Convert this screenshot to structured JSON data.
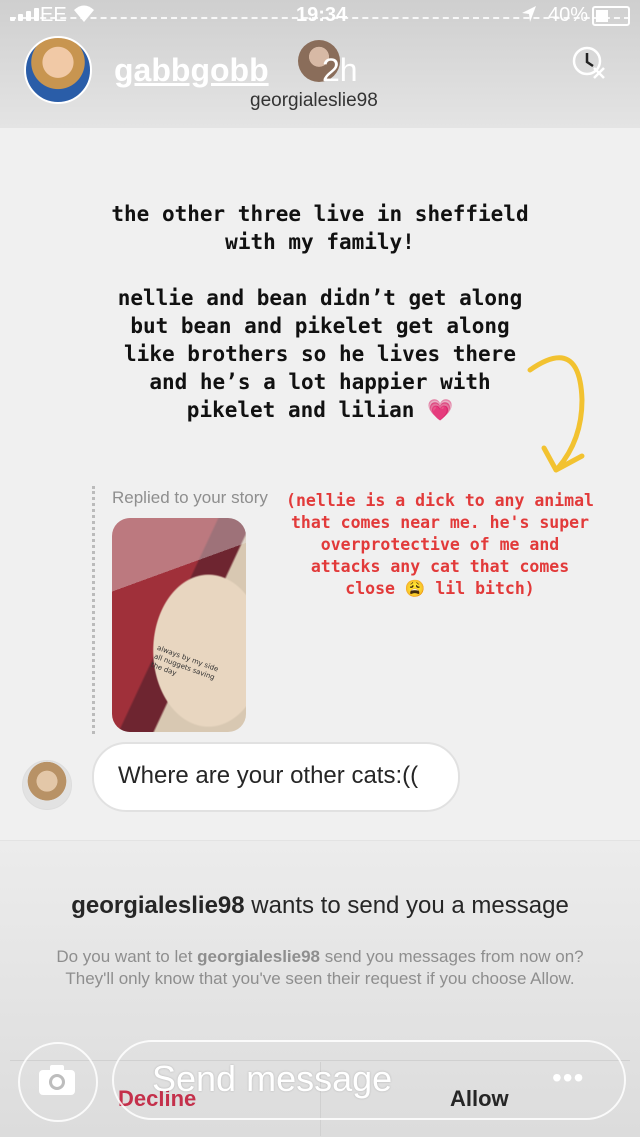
{
  "status_bar": {
    "carrier": "EE",
    "time": "19:34",
    "battery": "40%"
  },
  "story_header": {
    "username": "gabbgobb",
    "time_ago": "2h",
    "sender": "georgialeslie98"
  },
  "story": {
    "paragraph1": "the other three live in sheffield with my family!",
    "paragraph2": "nellie and bean didn’t get along but bean and pikelet get along like brothers so he lives there and he’s a lot happier with pikelet and lilian",
    "heart": "💗",
    "replied_label": "Replied to your story",
    "thumb_caption": "always by my side all nuggets saving the day",
    "red_note": "(nellie is a dick to any animal that comes near me. he's super overprotective of me and attacks any cat that comes close 😩 lil bitch)"
  },
  "message": {
    "text": "Where are your other cats:(("
  },
  "request": {
    "username": "georgialeslie98",
    "title_rest": " wants to send you a message",
    "desc_prefix": "Do you want to let ",
    "desc_suffix": " send you messages from now on? They'll only know that you've seen their request if you choose Allow.",
    "decline_label": "Decline",
    "allow_label": "Allow"
  },
  "bottom_bar": {
    "placeholder": "Send message",
    "more_label": "•••"
  },
  "colors": {
    "accent_red": "#e23a3a",
    "decline_red": "#c4304b",
    "arrow_yellow": "#f2c230",
    "heart_pink": "#e0478a"
  }
}
